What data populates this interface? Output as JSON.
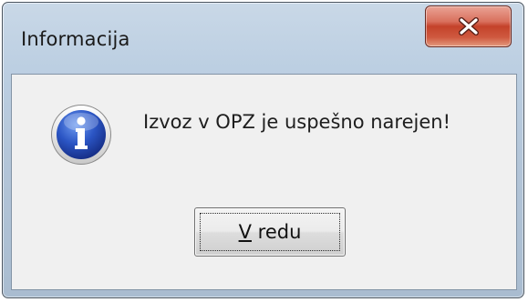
{
  "window": {
    "title": "Informacija"
  },
  "message": {
    "text": "Izvoz v OPZ je uspešno narejen!"
  },
  "ok_button": {
    "mnemonic": "V",
    "rest": " redu"
  },
  "icons": {
    "close": "close-x-icon",
    "info": "information-icon"
  },
  "colors": {
    "close_button": "#c94a33",
    "info_icon": "#2b55c4"
  }
}
